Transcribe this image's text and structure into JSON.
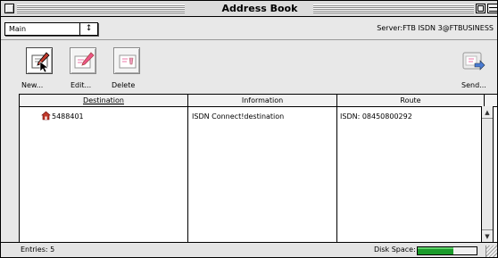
{
  "window": {
    "title": "Address Book"
  },
  "selector": {
    "value": "Main",
    "arrow": "↕"
  },
  "server": {
    "text": "Server:FTB ISDN 3@FTBUSINESS"
  },
  "toolbar": {
    "new_label": "New...",
    "edit_label": "Edit...",
    "delete_label": "Delete",
    "send_label": "Send..."
  },
  "table": {
    "headers": {
      "destination": "Destination",
      "information": "Information",
      "route": "Route"
    },
    "rows": [
      {
        "destination": "5488401",
        "information": "ISDN Connect!destination",
        "route": "ISDN: 08450800292",
        "icon": "house-icon"
      }
    ]
  },
  "scroll": {
    "up": "▲",
    "down": "▼"
  },
  "status": {
    "entries": "Entries: 5",
    "disk_label": "Disk Space:",
    "disk_fill_fraction": 0.6,
    "disk_fill_color": "#1a9a2a"
  }
}
